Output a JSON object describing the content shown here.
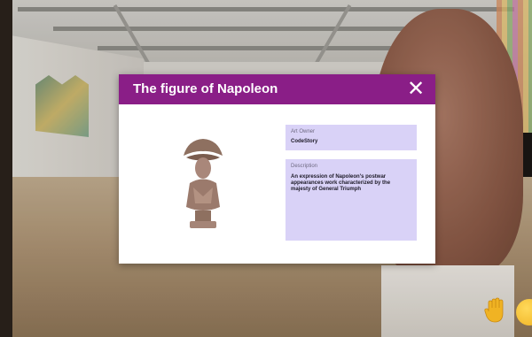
{
  "modal": {
    "title": "The figure of Napoleon",
    "close_icon": "close-icon",
    "artwork_image": "napoleon-bust-image",
    "owner": {
      "label": "Art Owner",
      "value": "CodeStory"
    },
    "description": {
      "label": "Description",
      "value": "An expression of Napoleon's postwar appearances work characterized by the majesty of General Triumph"
    }
  },
  "controls": {
    "raise_hand_icon": "raise-hand-icon",
    "emoji_icon": "emoji-icon"
  },
  "colors": {
    "header": "#8a1e87",
    "field_bg": "#d9d2f7",
    "hand": "#f0b323"
  }
}
